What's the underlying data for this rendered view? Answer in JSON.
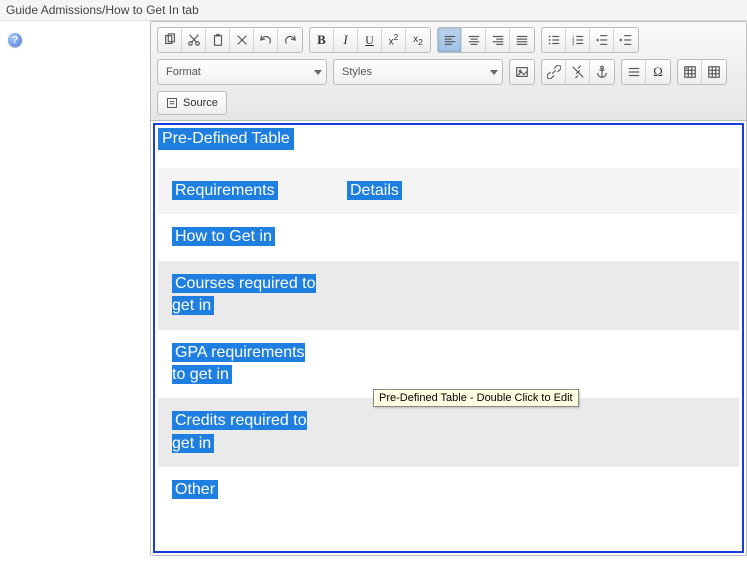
{
  "header": {
    "title": "Guide Admissions/How to Get In tab"
  },
  "help_icon_label": "?",
  "toolbar": {
    "format_label": "Format",
    "styles_label": "Styles",
    "source_label": "Source"
  },
  "content": {
    "widget_title": "Pre-Defined Table",
    "tooltip": "Pre-Defined Table - Double Click to Edit",
    "table": {
      "headers": {
        "col1": "Requirements",
        "col2": "Details"
      },
      "rows": [
        {
          "req": "How to Get in",
          "det": ""
        },
        {
          "req": "Courses required to get in",
          "det": ""
        },
        {
          "req": "GPA requirements to get in",
          "det": ""
        },
        {
          "req": "Credits required to get in",
          "det": ""
        },
        {
          "req": "Other",
          "det": ""
        }
      ]
    }
  }
}
